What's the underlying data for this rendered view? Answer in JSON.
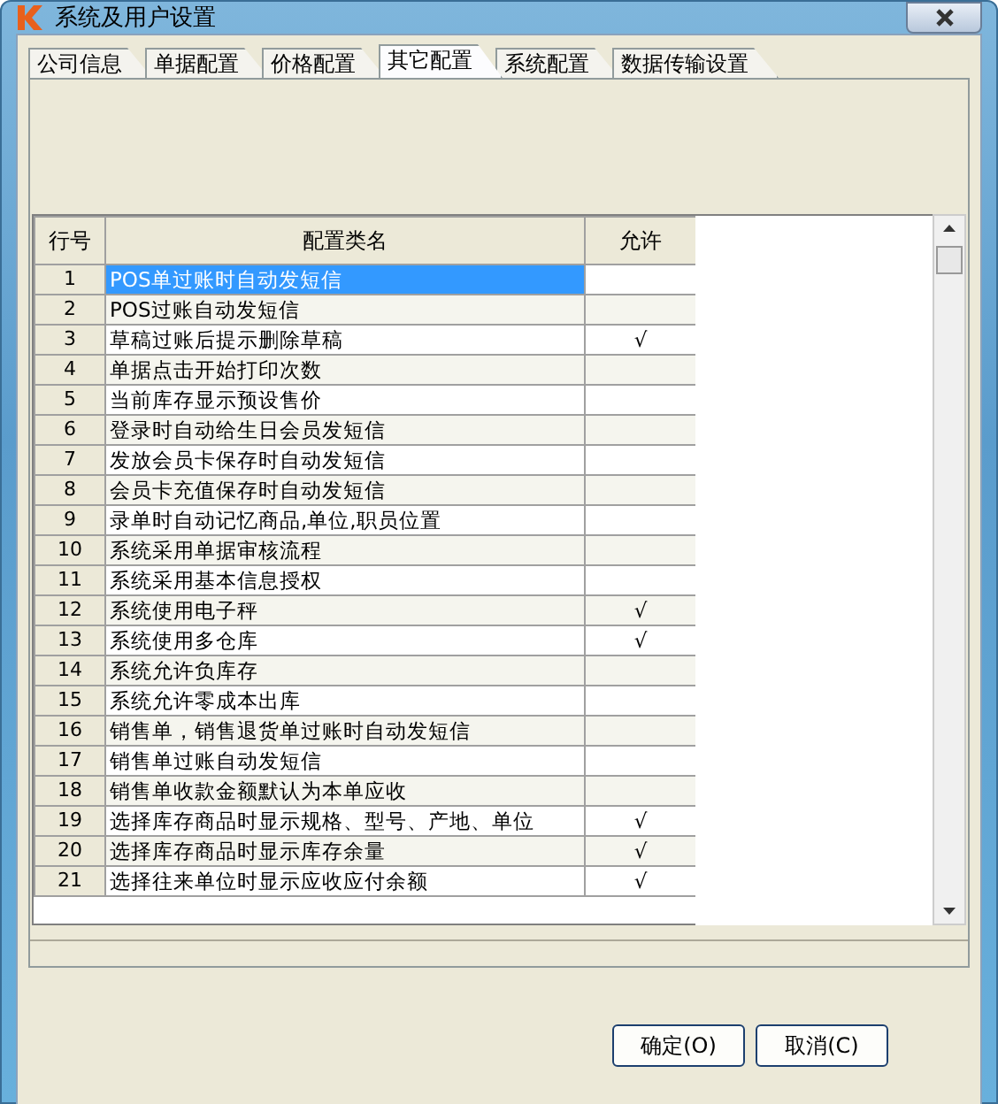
{
  "window": {
    "title": "系统及用户设置"
  },
  "tabs": [
    {
      "label": "公司信息",
      "selected": false
    },
    {
      "label": "单据配置",
      "selected": false
    },
    {
      "label": "价格配置",
      "selected": false
    },
    {
      "label": "其它配置",
      "selected": true
    },
    {
      "label": "系统配置",
      "selected": false
    },
    {
      "label": "数据传输设置",
      "selected": false
    }
  ],
  "table": {
    "columns": [
      "行号",
      "配置类名",
      "允许"
    ],
    "rows": [
      {
        "no": "1",
        "name": "POS单过账时自动发短信",
        "allowed": false,
        "selected": true
      },
      {
        "no": "2",
        "name": "POS过账自动发短信",
        "allowed": false,
        "selected": false
      },
      {
        "no": "3",
        "name": "草稿过账后提示删除草稿",
        "allowed": true,
        "selected": false
      },
      {
        "no": "4",
        "name": "单据点击开始打印次数",
        "allowed": false,
        "selected": false
      },
      {
        "no": "5",
        "name": "当前库存显示预设售价",
        "allowed": false,
        "selected": false
      },
      {
        "no": "6",
        "name": "登录时自动给生日会员发短信",
        "allowed": false,
        "selected": false
      },
      {
        "no": "7",
        "name": "发放会员卡保存时自动发短信",
        "allowed": false,
        "selected": false
      },
      {
        "no": "8",
        "name": "会员卡充值保存时自动发短信",
        "allowed": false,
        "selected": false
      },
      {
        "no": "9",
        "name": "录单时自动记忆商品,单位,职员位置",
        "allowed": false,
        "selected": false
      },
      {
        "no": "10",
        "name": "系统采用单据审核流程",
        "allowed": false,
        "selected": false
      },
      {
        "no": "11",
        "name": "系统采用基本信息授权",
        "allowed": false,
        "selected": false
      },
      {
        "no": "12",
        "name": "系统使用电子秤",
        "allowed": true,
        "selected": false
      },
      {
        "no": "13",
        "name": "系统使用多仓库",
        "allowed": true,
        "selected": false
      },
      {
        "no": "14",
        "name": "系统允许负库存",
        "allowed": false,
        "selected": false
      },
      {
        "no": "15",
        "name": "系统允许零成本出库",
        "allowed": false,
        "selected": false
      },
      {
        "no": "16",
        "name": "销售单，销售退货单过账时自动发短信",
        "allowed": false,
        "selected": false
      },
      {
        "no": "17",
        "name": "销售单过账自动发短信",
        "allowed": false,
        "selected": false
      },
      {
        "no": "18",
        "name": "销售单收款金额默认为本单应收",
        "allowed": false,
        "selected": false
      },
      {
        "no": "19",
        "name": "选择库存商品时显示规格、型号、产地、单位",
        "allowed": true,
        "selected": false
      },
      {
        "no": "20",
        "name": "选择库存商品时显示库存余量",
        "allowed": true,
        "selected": false
      },
      {
        "no": "21",
        "name": "选择往来单位时显示应收应付余额",
        "allowed": true,
        "selected": false
      }
    ],
    "check_mark": "√"
  },
  "buttons": [
    {
      "label": "确定(O)"
    },
    {
      "label": "取消(C)"
    }
  ]
}
